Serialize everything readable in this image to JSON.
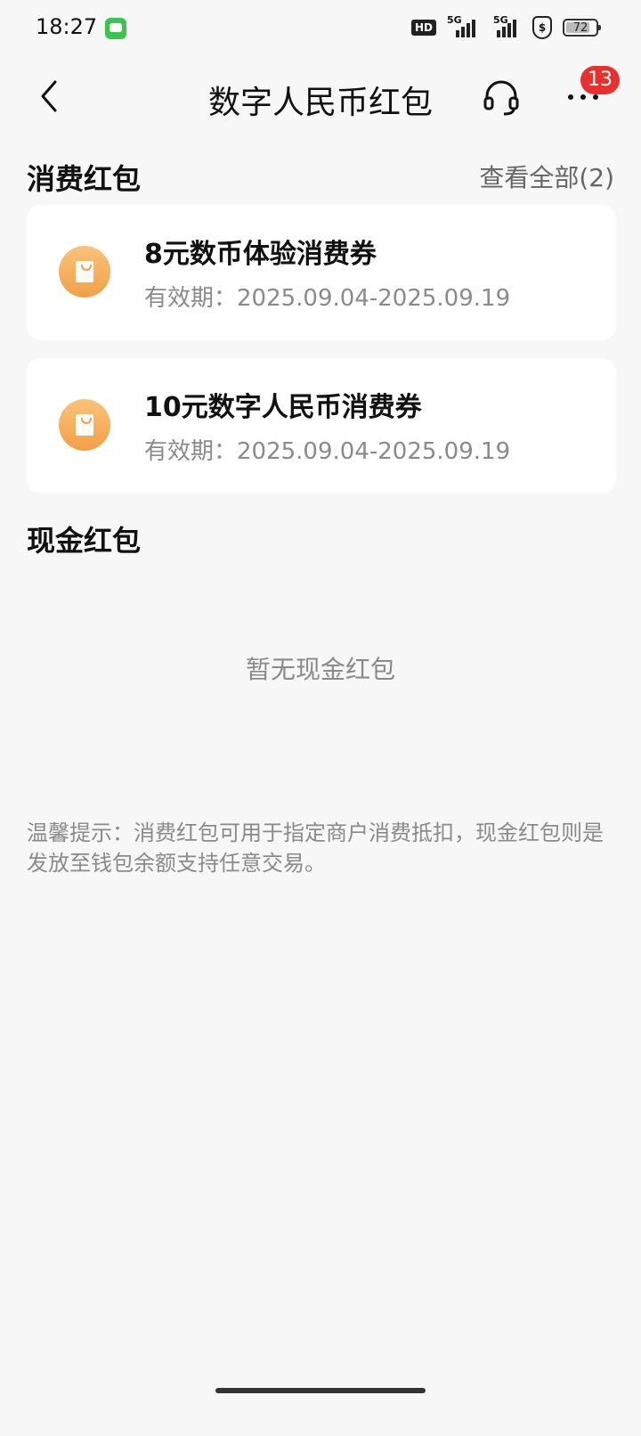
{
  "status_bar": {
    "time": "18:27",
    "hd_label": "HD",
    "network_1": "5G",
    "network_2": "5G",
    "battery": "72",
    "battery_level_percent": 72
  },
  "header": {
    "title": "数字人民币红包",
    "notification_badge": "13",
    "icons": {
      "back": "back-arrow-icon",
      "service": "headset-icon",
      "more": "more-icon"
    }
  },
  "consumption": {
    "section_title": "消费红包",
    "view_all_label": "查看全部(2)",
    "coupons": [
      {
        "title": "8元数币体验消费券",
        "validity": "有效期：2025.09.04-2025.09.19"
      },
      {
        "title": "10元数字人民币消费券",
        "validity": "有效期：2025.09.04-2025.09.19"
      }
    ]
  },
  "cash": {
    "section_title": "现金红包",
    "empty_text": "暂无现金红包"
  },
  "tips": "温馨提示：消费红包可用于指定商户消费抵扣，现金红包则是发放至钱包余额支持任意交易。",
  "colors": {
    "background": "#f7f7f7",
    "card": "#ffffff",
    "badge": "#e8312f",
    "coupon_icon": "#f2a047",
    "secondary_text": "#8a8a8a"
  }
}
